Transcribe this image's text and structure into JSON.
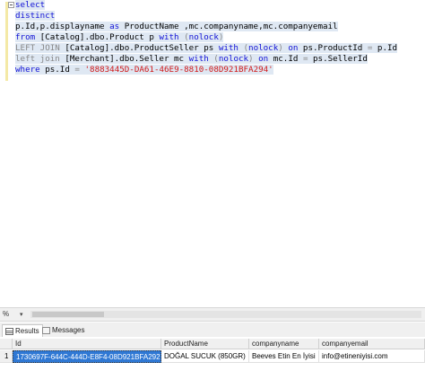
{
  "editor": {
    "lines": [
      {
        "segments": [
          {
            "t": "select",
            "c": "kw"
          }
        ]
      },
      {
        "segments": [
          {
            "t": "distinct",
            "c": "kw"
          }
        ]
      },
      {
        "segments": [
          {
            "t": "p.Id,p.displayname ",
            "c": "id"
          },
          {
            "t": "as",
            "c": "kw"
          },
          {
            "t": " ProductName ,mc.companyname,mc.companyemail",
            "c": "id"
          }
        ]
      },
      {
        "segments": [
          {
            "t": "from",
            "c": "kw"
          },
          {
            "t": " [Catalog].dbo.Product p ",
            "c": "id"
          },
          {
            "t": "with",
            "c": "kw"
          },
          {
            "t": " (",
            "c": "gr"
          },
          {
            "t": "nolock",
            "c": "kw"
          },
          {
            "t": ")",
            "c": "gr"
          }
        ]
      },
      {
        "segments": [
          {
            "t": "LEFT JOIN",
            "c": "gr"
          },
          {
            "t": " [Catalog].dbo.ProductSeller ps ",
            "c": "id"
          },
          {
            "t": "with",
            "c": "kw"
          },
          {
            "t": " (",
            "c": "gr"
          },
          {
            "t": "nolock",
            "c": "kw"
          },
          {
            "t": ") ",
            "c": "gr"
          },
          {
            "t": "on",
            "c": "kw"
          },
          {
            "t": " ps.ProductId ",
            "c": "id"
          },
          {
            "t": "=",
            "c": "gr"
          },
          {
            "t": " p.Id",
            "c": "id"
          }
        ]
      },
      {
        "segments": [
          {
            "t": "left join",
            "c": "gr"
          },
          {
            "t": " [Merchant].dbo.Seller mc ",
            "c": "id"
          },
          {
            "t": "with",
            "c": "kw"
          },
          {
            "t": " (",
            "c": "gr"
          },
          {
            "t": "nolock",
            "c": "kw"
          },
          {
            "t": ") ",
            "c": "gr"
          },
          {
            "t": "on",
            "c": "kw"
          },
          {
            "t": " mc.Id ",
            "c": "id"
          },
          {
            "t": "=",
            "c": "gr"
          },
          {
            "t": " ps.SellerId",
            "c": "id"
          }
        ]
      },
      {
        "segments": [
          {
            "t": "where",
            "c": "kw"
          },
          {
            "t": " ps.Id ",
            "c": "id"
          },
          {
            "t": "=",
            "c": "gr"
          },
          {
            "t": " ",
            "c": "id"
          },
          {
            "t": "'8883445D-DA61-46E9-8810-08D921BFA294'",
            "c": "str"
          }
        ]
      }
    ]
  },
  "status": {
    "zoom": "%"
  },
  "tabs": [
    {
      "label": "Results",
      "icon": "grid-icon",
      "active": true
    },
    {
      "label": "Messages",
      "icon": "messages-icon",
      "active": false
    }
  ],
  "grid": {
    "columns": [
      "Id",
      "ProductName",
      "companyname",
      "companyemail"
    ],
    "rows": [
      {
        "num": "1",
        "cells": [
          "1730697F-644C-444D-E8F4-08D921BFA292",
          "DOĞAL SUCUK (850GR)",
          "Beeves Etin En İyisi",
          "info@etineniyisi.com"
        ]
      }
    ]
  },
  "colors": {
    "keyword": "#1212d6",
    "string": "#d01818",
    "operator": "#888888",
    "selection": "#dfe8f3",
    "selected_cell": "#2f78d4"
  }
}
